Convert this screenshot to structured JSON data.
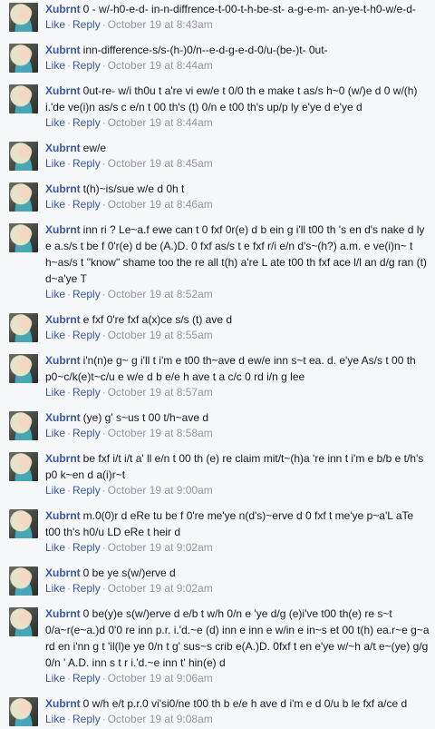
{
  "comments": [
    {
      "author": "Xubrnt",
      "text": "0 - w/-h0-e-d- in-n-diffrence-t-00-t-h-be-st- a-g-e-m- an-ye-t-h0-w/e-d-",
      "like": "Like",
      "reply": "Reply",
      "timestamp": "October 19 at 8:43am"
    },
    {
      "author": "Xubrnt",
      "text": "inn-difference-s/s-(h-)0/n--e-d-g-e-d-0/u-(be-)t- 0ut-",
      "like": "Like",
      "reply": "Reply",
      "timestamp": "October 19 at 8:44am"
    },
    {
      "author": "Xubrnt",
      "text": "0ut-re- w/i th0u t a're vi ew/e t 0/0 th e make t as/s h~0 (w/)e d 0 w/(h) i.'de ve(i)n as/s c e/n t 00 th's (t) 0/n e t00 th's up/p ly e'ye d e'ye d",
      "like": "Like",
      "reply": "Reply",
      "timestamp": "October 19 at 8:44am"
    },
    {
      "author": "Xubrnt",
      "text": "ew/e",
      "like": "Like",
      "reply": "Reply",
      "timestamp": "October 19 at 8:45am"
    },
    {
      "author": "Xubrnt",
      "text": "t(h)~is/sue w/e d 0h t",
      "like": "Like",
      "reply": "Reply",
      "timestamp": "October 19 at 8:46am"
    },
    {
      "author": "Xubrnt",
      "text": "inn ri ? Le~a.f ewe can t 0 fxf 0r(e) d b ein g i'll t00 th 's en d's nake d ly e a.s/s t be f 0'r(e) d be (A.)D. 0 fxf as/s t e fxf r/i e/n d's~(h?) a.m. e ve(i)n~ t h~as/s t \"know\" shame too the re all t(h) a're L ate t00 th fxf ace l/l an d/g ran (t) d~a'ye T",
      "like": "Like",
      "reply": "Reply",
      "timestamp": "October 19 at 8:52am"
    },
    {
      "author": "Xubrnt",
      "text": "e fxf 0're fxf a(x)ce s/s (t) ave d",
      "like": "Like",
      "reply": "Reply",
      "timestamp": "October 19 at 8:55am"
    },
    {
      "author": "Xubrnt",
      "text": "i'n(n)e g~ g i'll t i'm e t00 th~ave d ew/e inn s~t ea. d. e'ye As/s t 00 th p0~c/k(e)t~c/u e w/e d b e/e h ave t a c/c 0 rd i/n g lee",
      "like": "Like",
      "reply": "Reply",
      "timestamp": "October 19 at 8:57am"
    },
    {
      "author": "Xubrnt",
      "text": "(ye) g' s~us t 00 t/h~ave d",
      "like": "Like",
      "reply": "Reply",
      "timestamp": "October 19 at 8:58am"
    },
    {
      "author": "Xubrnt",
      "text": "be fxf i/t i/t a' ll e/n t 00 th (e) re claim mit/t~(h)a 're inn t i'm e b/b e t/h's p0 k~en d a(i)r~t",
      "like": "Like",
      "reply": "Reply",
      "timestamp": "October 19 at 9:00am"
    },
    {
      "author": "Xubrnt",
      "text": "m.0(0)r d eRe tu be f 0're me'ye n(d's)~erve d 0 fxf t me'ye p~a'L aTe t00 th's h0/u LD eRe t heir d",
      "like": "Like",
      "reply": "Reply",
      "timestamp": "October 19 at 9:02am"
    },
    {
      "author": "Xubrnt",
      "text": "0 be ye s(w/)erve d",
      "like": "Like",
      "reply": "Reply",
      "timestamp": "October 19 at 9:02am"
    },
    {
      "author": "Xubrnt",
      "text": "0 be(y)e s(w/)erve d e/b t w/h 0/n e 'ye d/g (e)i've t00 th(e) re s~t 0/a~r(e~a.)d 0'0 re inn p.r. i.'d.~e (d) inn e inn e w/in e in~s et 00 t(h) ea.r~e g~a rd en i'nn g t 'il(l)e ye 0/n t g' sus~s crib e(A.)D. 0fxf t en e'ye w/~h a/t e~(ye) g/g 0/n ' A.D. inn s t r i.'d.~e inn t' hin(e) d",
      "like": "Like",
      "reply": "Reply",
      "timestamp": "October 19 at 9:06am"
    },
    {
      "author": "Xubrnt",
      "text": "0 w/h e/t p.r.0 vi'si0/ne t00 th b e/e h ave d i'm e d 0/u b le fxf a/ce d",
      "like": "Like",
      "reply": "Reply",
      "timestamp": "October 19 at 9:08am"
    }
  ],
  "colors": {
    "link": "#3b5998",
    "muted": "#9197a3",
    "text": "#141823",
    "background": "#f6f7f9"
  }
}
